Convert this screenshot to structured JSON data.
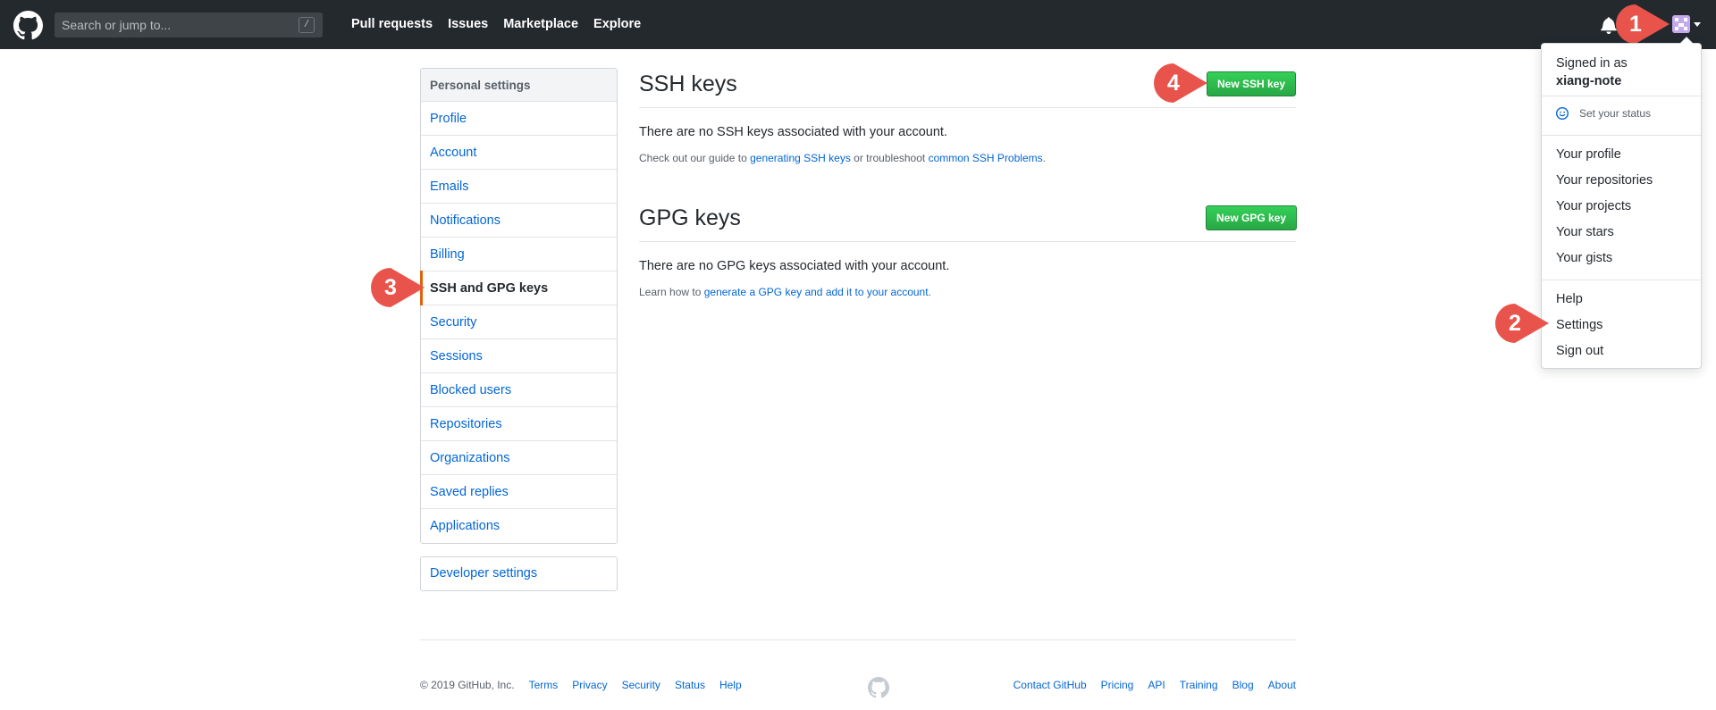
{
  "header": {
    "search_placeholder": "Search or jump to...",
    "search_shortcut": "/",
    "nav": [
      "Pull requests",
      "Issues",
      "Marketplace",
      "Explore"
    ]
  },
  "user_menu": {
    "signed_in_prefix": "Signed in as",
    "username": "xiang-note",
    "set_status": "Set your status",
    "group1": [
      "Your profile",
      "Your repositories",
      "Your projects",
      "Your stars",
      "Your gists"
    ],
    "group2": [
      "Help",
      "Settings",
      "Sign out"
    ]
  },
  "sidebar": {
    "heading": "Personal settings",
    "items": [
      "Profile",
      "Account",
      "Emails",
      "Notifications",
      "Billing",
      "SSH and GPG keys",
      "Security",
      "Sessions",
      "Blocked users",
      "Repositories",
      "Organizations",
      "Saved replies",
      "Applications"
    ],
    "selected": "SSH and GPG keys",
    "developer_settings": "Developer settings"
  },
  "ssh": {
    "title": "SSH keys",
    "button": "New SSH key",
    "empty": "There are no SSH keys associated with your account.",
    "guide_prefix": "Check out our guide to",
    "guide_link": "generating SSH keys",
    "guide_mid": "or troubleshoot",
    "guide_link2": "common SSH Problems",
    "guide_suffix": "."
  },
  "gpg": {
    "title": "GPG keys",
    "button": "New GPG key",
    "empty": "There are no GPG keys associated with your account.",
    "learn_prefix": "Learn how to",
    "learn_link": "generate a GPG key and add it to your account",
    "learn_suffix": "."
  },
  "footer": {
    "copyright": "© 2019 GitHub, Inc.",
    "left_links": [
      "Terms",
      "Privacy",
      "Security",
      "Status",
      "Help"
    ],
    "right_links": [
      "Contact GitHub",
      "Pricing",
      "API",
      "Training",
      "Blog",
      "About"
    ]
  },
  "markers": [
    "1",
    "2",
    "3",
    "4"
  ],
  "colors": {
    "header_bg": "#24292e",
    "link": "#0366d6",
    "button_green": "#28a745",
    "marker": "#e8544c",
    "selected_accent": "#e36209"
  },
  "icons": [
    "github-logo-icon",
    "bell-icon",
    "caret-down-icon",
    "smiley-icon",
    "github-mark-icon"
  ]
}
